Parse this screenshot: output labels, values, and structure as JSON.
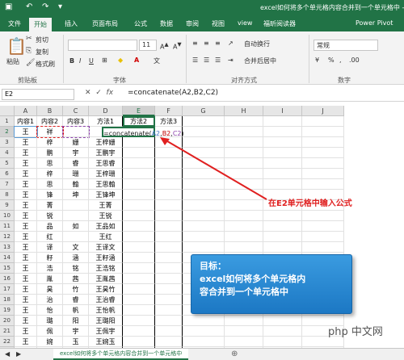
{
  "window": {
    "title": "excel如何将多个单元格内容合并到一个单元格中 - Excel"
  },
  "tabs": [
    "文件",
    "开始",
    "插入",
    "页面布局",
    "公式",
    "数据",
    "审阅",
    "视图",
    "view",
    "福昕阅读器",
    "Power Pivot"
  ],
  "ribbon": {
    "paste": "粘贴",
    "cut": "剪切",
    "copy": "复制",
    "format_painter": "格式刷",
    "clipboard_group": "剪贴板",
    "font_group": "字体",
    "font_size": "11",
    "bold": "B",
    "italic": "I",
    "underline": "U",
    "wrap": "自动换行",
    "merge": "合并后居中",
    "align_group": "对齐方式",
    "number_format": "常规",
    "number_group": "数字",
    "percent": "%",
    "comma": ","
  },
  "formula_bar": {
    "name_box": "E2",
    "formula": "=concatenate(A2,B2,C2)"
  },
  "columns": [
    "A",
    "B",
    "C",
    "D",
    "E",
    "F",
    "G",
    "H",
    "I",
    "J"
  ],
  "rows": [
    [
      "内容1",
      "内容2",
      "内容3",
      "方法1",
      "方法2",
      "方法3"
    ],
    [
      "王",
      "祥",
      "",
      "",
      "",
      ""
    ],
    [
      "王",
      "梓",
      "姗",
      "王梓姗",
      "",
      ""
    ],
    [
      "王",
      "鹏",
      "宇",
      "王鹏宇",
      "",
      ""
    ],
    [
      "王",
      "思",
      "睿",
      "王思睿",
      "",
      ""
    ],
    [
      "王",
      "梓",
      "珊",
      "王梓珊",
      "",
      ""
    ],
    [
      "王",
      "思",
      "翰",
      "王思翰",
      "",
      ""
    ],
    [
      "王",
      "锋",
      "坤",
      "王锋坤",
      "",
      ""
    ],
    [
      "王",
      "菁",
      "",
      "王菁",
      "",
      ""
    ],
    [
      "王",
      "锐",
      "",
      "王锐",
      "",
      ""
    ],
    [
      "王",
      "品",
      "如",
      "王品如",
      "",
      ""
    ],
    [
      "王",
      "红",
      "",
      "王红",
      "",
      ""
    ],
    [
      "王",
      "译",
      "文",
      "王译文",
      "",
      ""
    ],
    [
      "王",
      "籽",
      "涵",
      "王籽涵",
      "",
      ""
    ],
    [
      "王",
      "浩",
      "铭",
      "王浩铭",
      "",
      ""
    ],
    [
      "王",
      "胤",
      "茜",
      "王胤茜",
      "",
      ""
    ],
    [
      "王",
      "昊",
      "竹",
      "王昊竹",
      "",
      ""
    ],
    [
      "王",
      "治",
      "睿",
      "王治睿",
      "",
      ""
    ],
    [
      "王",
      "怡",
      "帆",
      "王怡帆",
      "",
      ""
    ],
    [
      "王",
      "璐",
      "阳",
      "王璐阳",
      "",
      ""
    ],
    [
      "王",
      "佩",
      "宇",
      "王佩宇",
      "",
      ""
    ],
    [
      "王",
      "婉",
      "玉",
      "王婉玉",
      "",
      ""
    ],
    [
      "王",
      "嘉",
      "",
      "王嘉",
      "",
      ""
    ]
  ],
  "edit_cell": {
    "prefix": "=concatenate(",
    "a": "A2",
    "comma1": ",",
    "b": "B2",
    "comma2": ",",
    "c": "C2",
    "suffix": ")"
  },
  "annotation": "在E2单元格中输入公式",
  "callout": {
    "line1": "目标：",
    "line2": "excel如何将多个单元格内",
    "line3": "容合并到一个单元格中"
  },
  "sheet_tab": "excel如何将多个单元格内容合并到一个单元格中",
  "add_sheet": "⊕",
  "watermark": "php 中文网"
}
